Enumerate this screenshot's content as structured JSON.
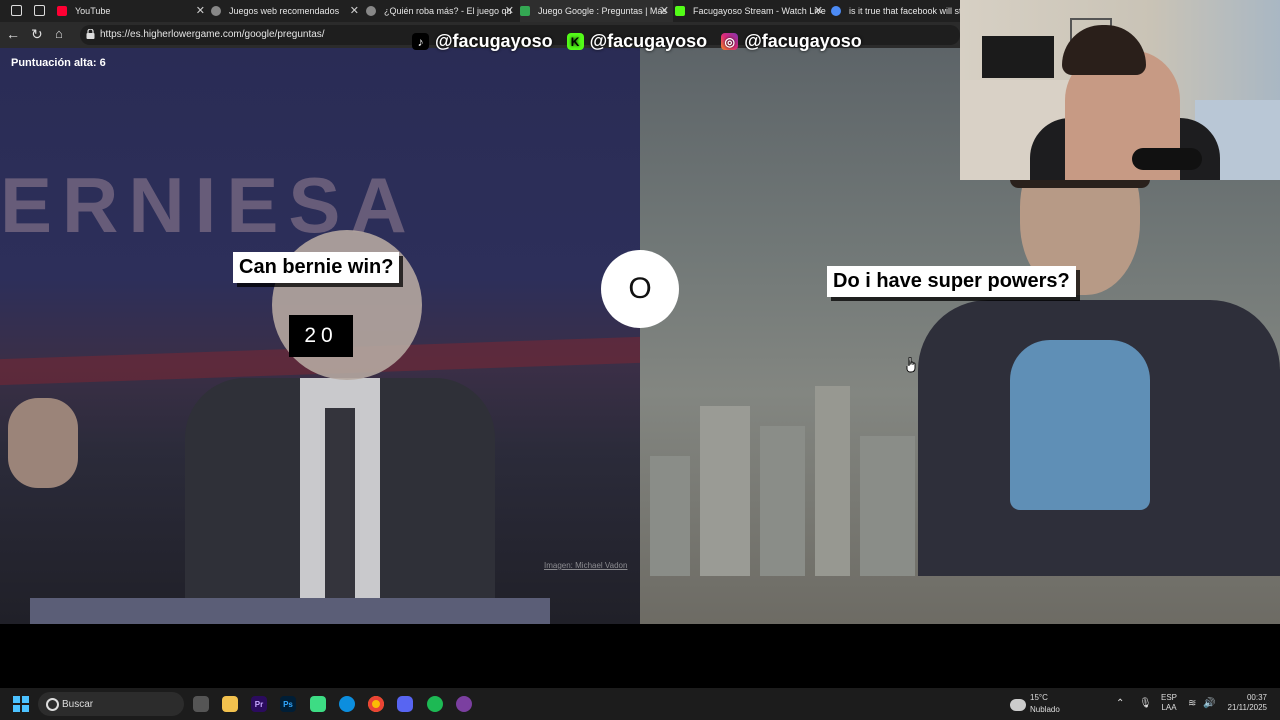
{
  "browser": {
    "tabs": [
      {
        "label": "YouTube",
        "color": "#ff0033"
      },
      {
        "label": "Juegos web recomendados",
        "color": "#bbbbbb"
      },
      {
        "label": "¿Quién roba más? - El juego qu",
        "color": "#bbbbbb"
      },
      {
        "label": "Juego Google : Preguntas | Más",
        "color": "#34a853",
        "active": true
      },
      {
        "label": "Facugayoso Stream - Watch Live",
        "color": "#53fc18"
      },
      {
        "label": "is it true that facebook will start",
        "color": "#4c8bf5"
      }
    ],
    "url": "https://es.higherlowergame.com/google/preguntas/"
  },
  "game": {
    "high_score_label": "Puntuación alta: 6",
    "left_question": "Can bernie win?",
    "left_count": "20",
    "left_banner_text": "ERNIESA",
    "right_question": "Do i have super powers?",
    "vs_label": "O",
    "image_credit": "Imagen: Michael Vadon"
  },
  "overlay": {
    "handles": [
      {
        "icon": "tiktok-icon",
        "text": "@facugayoso",
        "color": "#000000"
      },
      {
        "icon": "kick-icon",
        "text": "@facugayoso",
        "color": "#53fc18"
      },
      {
        "icon": "instagram-icon",
        "text": "@facugayoso",
        "color": "#d62976"
      }
    ]
  },
  "taskbar": {
    "search_label": "Buscar",
    "weather_temp": "15°C",
    "weather_desc": "Nublado",
    "lang_top": "ESP",
    "lang_bottom": "LAA",
    "time": "00:37",
    "date": "21/11/2025",
    "apps": [
      "file-explorer-icon",
      "premiere-icon",
      "photoshop-icon",
      "terminal-icon",
      "edge-icon",
      "chrome-icon",
      "discord-icon",
      "spotify-icon",
      "app-icon"
    ]
  }
}
